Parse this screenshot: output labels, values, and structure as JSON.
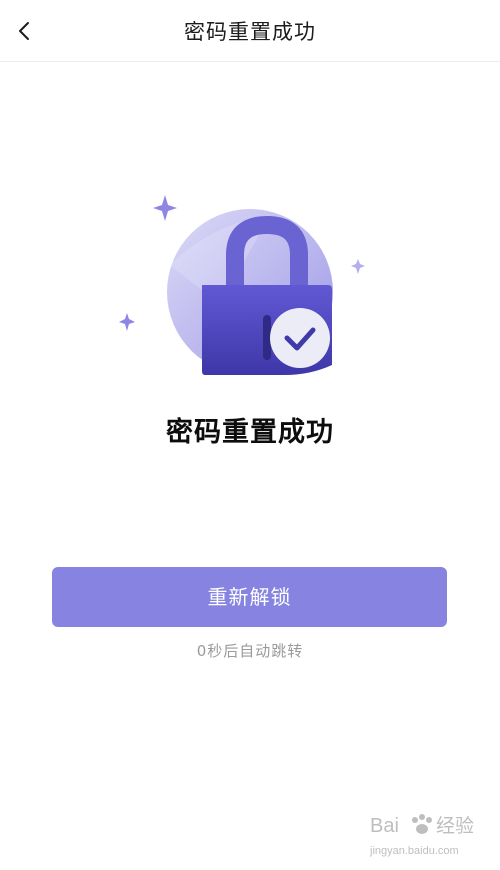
{
  "header": {
    "title": "密码重置成功",
    "back_icon": "chevron-left-icon"
  },
  "illustration": {
    "icon": "lock-check-icon",
    "colors": {
      "lock_body": "#5a52c9",
      "shackle": "#6a63d2",
      "circle_bg": "#b9b5ee",
      "check_badge_bg": "#ececf7",
      "check_mark": "#3f3aa7",
      "sparkle": "#8d86e4"
    }
  },
  "result": {
    "title": "密码重置成功"
  },
  "actions": {
    "unlock_label": "重新解锁",
    "redirect_text": "0秒后自动跳转"
  },
  "watermark": {
    "brand": "Bai",
    "brand_suffix": "经验",
    "domain": "jingyan.baidu.com"
  },
  "colors": {
    "primary_button": "#8684e0",
    "divider": "#ececec",
    "secondary_text": "#9a9a9a"
  }
}
